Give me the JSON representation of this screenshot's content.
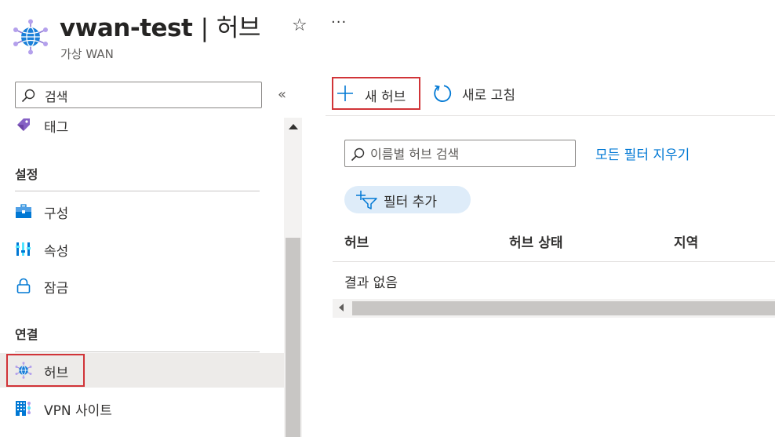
{
  "header": {
    "resource_name": "vwan-test",
    "separator": "|",
    "page_name": "허브",
    "subtitle": "가상 WAN",
    "favorite_glyph": "☆",
    "more_glyph": "···",
    "logo_icon": "virtual-wan-globe-icon"
  },
  "sidebar": {
    "search_placeholder": "검색",
    "collapse_glyph": "«",
    "items_top": [
      {
        "label": "태그",
        "icon": "tag-icon"
      }
    ],
    "groups": [
      {
        "title": "설정",
        "items": [
          {
            "label": "구성",
            "icon": "toolbox-icon"
          },
          {
            "label": "속성",
            "icon": "properties-icon"
          },
          {
            "label": "잠금",
            "icon": "lock-icon"
          }
        ]
      },
      {
        "title": "연결",
        "items": [
          {
            "label": "허브",
            "icon": "hub-globe-icon",
            "selected": true
          },
          {
            "label": "VPN 사이트",
            "icon": "vpn-site-building-icon"
          }
        ]
      }
    ]
  },
  "toolbar": {
    "new_hub_label": "새 허브",
    "refresh_label": "새로 고침"
  },
  "filters": {
    "search_placeholder": "이름별 허브 검색",
    "clear_all_label": "모든 필터 지우기",
    "add_filter_label": "필터 추가"
  },
  "table": {
    "columns": [
      "허브",
      "허브 상태",
      "지역"
    ],
    "empty_message": "결과 없음"
  },
  "colors": {
    "accent": "#0078d4",
    "highlight_border": "#d13438",
    "selected_bg": "#edebe9",
    "pill_bg": "#deecf9"
  }
}
